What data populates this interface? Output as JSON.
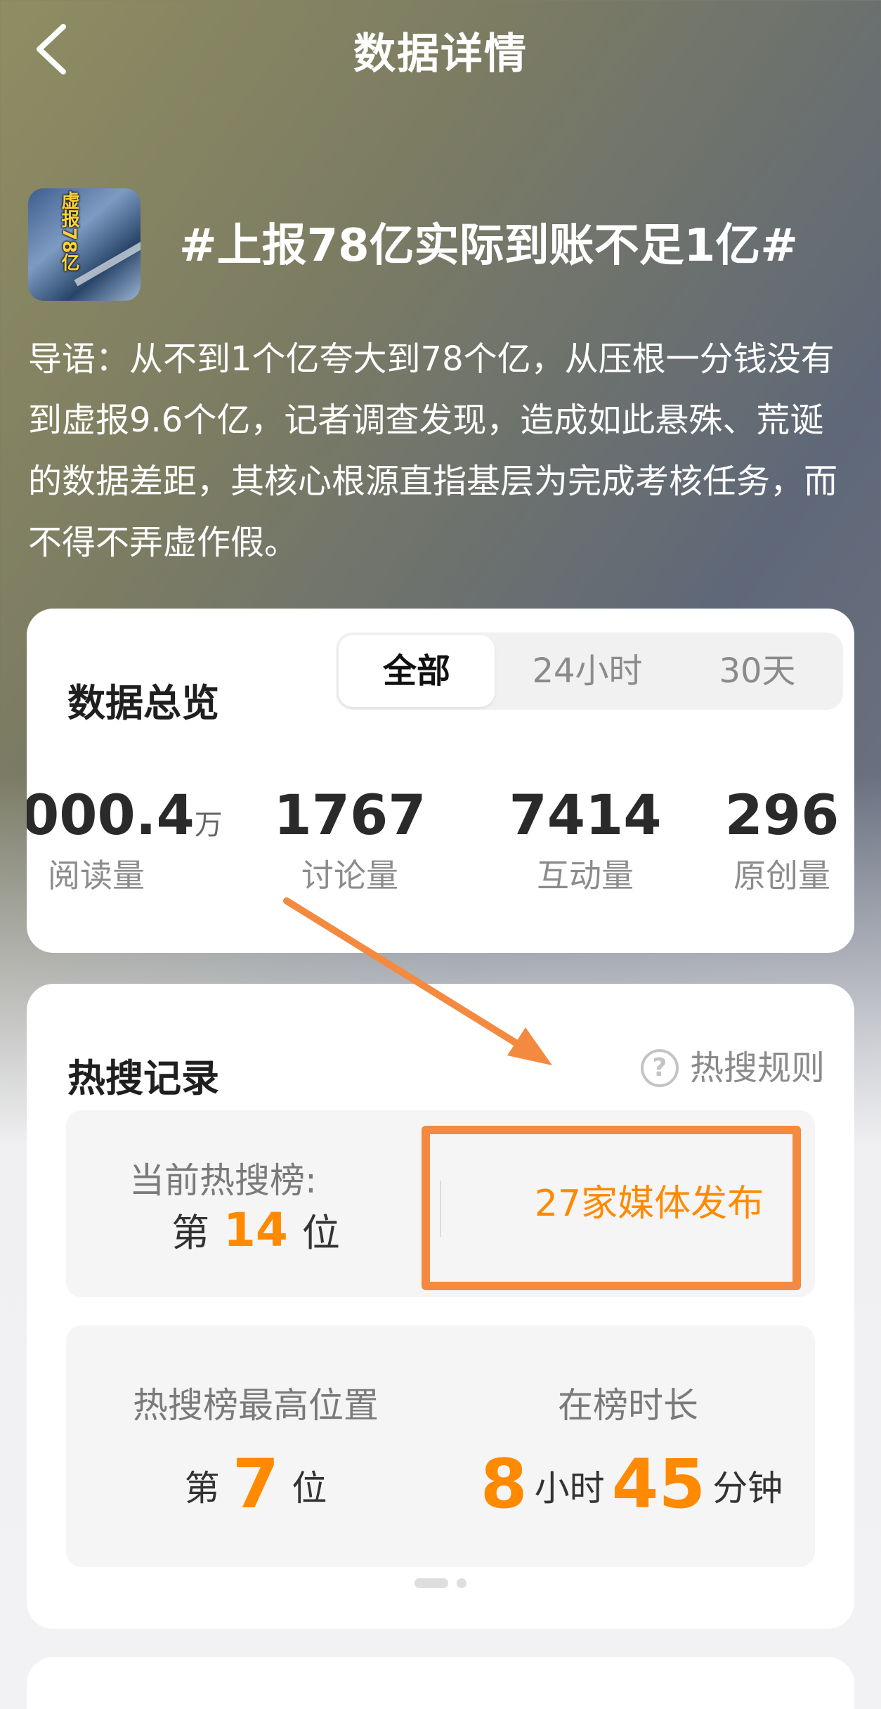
{
  "header": {
    "title": "数据详情",
    "back_icon": "chevron-left-icon"
  },
  "topic": {
    "title": "#上报78亿实际到账不足1亿#",
    "thumbnail_text": "虚报78亿",
    "intro": "导语：从不到1个亿夸大到78个亿，从压根一分钱没有到虚报9.6个亿，记者调查发现，造成如此悬殊、荒诞的数据差距，其核心根源直指基层为完成考核任务，而不得不弄虚作假。"
  },
  "overview": {
    "title": "数据总览",
    "tabs": [
      {
        "label": "全部",
        "active": true
      },
      {
        "label": "24小时",
        "active": false
      },
      {
        "label": "30天",
        "active": false
      }
    ],
    "stats": [
      {
        "value": "000.4",
        "unit": "万",
        "label": "阅读量"
      },
      {
        "value": "1767",
        "label": "讨论量"
      },
      {
        "value": "7414",
        "label": "互动量"
      },
      {
        "value": "296",
        "label": "原创量"
      }
    ]
  },
  "hot_search": {
    "title": "热搜记录",
    "rules_label": "热搜规则",
    "current_label": "当前热搜榜:",
    "current_rank_prefix": "第",
    "current_rank": "14",
    "current_rank_suffix": "位",
    "media_label": "27家媒体发布",
    "highest_label": "热搜榜最高位置",
    "highest_prefix": "第",
    "highest_rank": "7",
    "highest_suffix": "位",
    "duration_label": "在榜时长",
    "duration_hours": "8",
    "duration_hours_unit": "小时",
    "duration_minutes": "45",
    "duration_minutes_unit": "分钟"
  },
  "colors": {
    "accent": "#ff8a00",
    "annotation": "#f38a3f"
  }
}
